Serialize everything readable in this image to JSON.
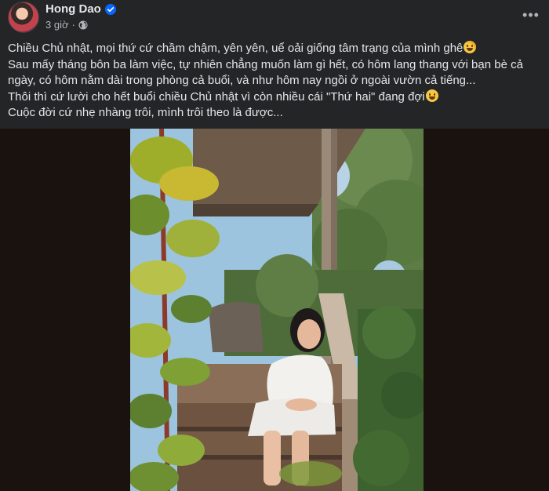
{
  "post": {
    "author_name": "Hong Dao",
    "timestamp": "3 giờ",
    "verified_icon": "verified-badge-icon",
    "privacy_icon": "globe-icon",
    "more_label": "•••",
    "text_lines": [
      "Chiều Chủ nhật, mọi thứ cứ chầm chậm, yên yên, uể oải giống tâm trạng của mình ghê",
      "Sau mấy tháng bôn ba làm việc, tự nhiên chẳng muốn làm gì hết, có hôm lang thang với bạn bè cả",
      "ngày, có hôm nằm dài trong phòng cả buổi, và như hôm nay ngồi ở ngoài vườn cả tiếng...",
      "Thôi thì cứ lười cho hết buổi chiều Chủ nhật vì còn nhiều cái \"Thứ hai\" đang đợi",
      "Cuộc đời cứ nhẹ nhàng trôi, mình trôi theo là được..."
    ],
    "emojis": [
      "grinning-sweat-emoji",
      "grinning-emoji"
    ]
  },
  "colors": {
    "background": "#242526",
    "text": "#e4e6eb",
    "secondary_text": "#b0b3b8",
    "verified_blue": "#0866ff"
  }
}
